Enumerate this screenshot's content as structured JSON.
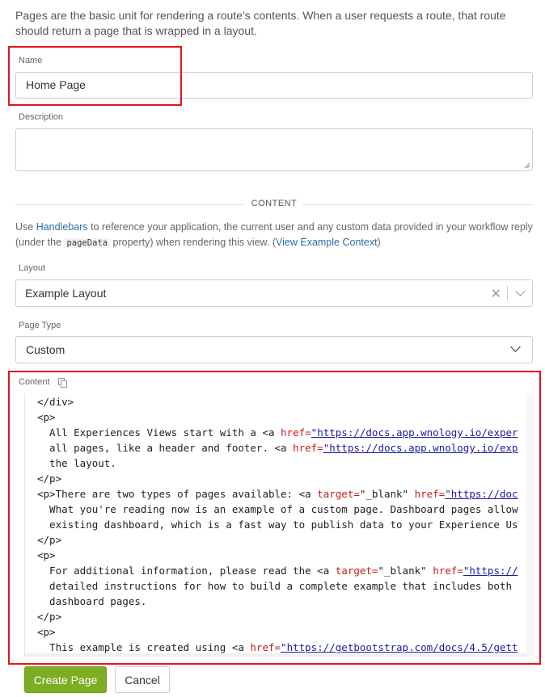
{
  "intro": "Pages are the basic unit for rendering a route's contents. When a user requests a route, that route should return a page that is wrapped in a layout.",
  "name_field": {
    "label": "Name",
    "value": "Home Page"
  },
  "description_field": {
    "label": "Description",
    "value": ""
  },
  "content_divider": "CONTENT",
  "help": {
    "use": "Use ",
    "handlebars_link": "Handlebars",
    "text1": " to reference your application, the current user and any custom data provided in your workflow reply (under the ",
    "code": "pageData",
    "text2": " property) when rendering this view. (",
    "context_link": "View Example Context",
    "text3": ")"
  },
  "layout_field": {
    "label": "Layout",
    "value": "Example Layout"
  },
  "page_type_field": {
    "label": "Page Type",
    "value": "Custom"
  },
  "content_field": {
    "label": "Content"
  },
  "code_lines": [
    [
      {
        "t": "</div>"
      }
    ],
    [
      {
        "t": "<p>"
      }
    ],
    [
      {
        "t": "  All Experiences Views start with a <a "
      },
      {
        "t": "href=",
        "c": "attr"
      },
      {
        "t": "\"https://docs.app.wnology.io/exper",
        "c": "str"
      }
    ],
    [
      {
        "t": "  all pages, like a header and footer. <a "
      },
      {
        "t": "href=",
        "c": "attr"
      },
      {
        "t": "\"https://docs.app.wnology.io/exp",
        "c": "str"
      }
    ],
    [
      {
        "t": "  the layout."
      }
    ],
    [
      {
        "t": "</p>"
      }
    ],
    [
      {
        "t": "<p>There are two types of pages available: <a "
      },
      {
        "t": "target=",
        "c": "attr"
      },
      {
        "t": "\"_blank\" "
      },
      {
        "t": "href=",
        "c": "attr"
      },
      {
        "t": "\"https://doc",
        "c": "str"
      }
    ],
    [
      {
        "t": "  What you're reading now is an example of a custom page. Dashboard pages allow"
      }
    ],
    [
      {
        "t": "  existing dashboard, which is a fast way to publish data to your Experience Us"
      }
    ],
    [
      {
        "t": "</p>"
      }
    ],
    [
      {
        "t": "<p>"
      }
    ],
    [
      {
        "t": "  For additional information, please read the <a "
      },
      {
        "t": "target=",
        "c": "attr"
      },
      {
        "t": "\"_blank\" "
      },
      {
        "t": "href=",
        "c": "attr"
      },
      {
        "t": "\"https://",
        "c": "str"
      }
    ],
    [
      {
        "t": "  detailed instructions for how to build a complete example that includes both"
      }
    ],
    [
      {
        "t": "  dashboard pages."
      }
    ],
    [
      {
        "t": "</p>"
      }
    ],
    [
      {
        "t": "<p>"
      }
    ],
    [
      {
        "t": "  This example is created using <a "
      },
      {
        "t": "href=",
        "c": "attr"
      },
      {
        "t": "\"https://getbootstrap.com/docs/4.5/gett",
        "c": "str"
      }
    ]
  ],
  "buttons": {
    "create": "Create Page",
    "cancel": "Cancel"
  },
  "colors": {
    "primary": "#7cad22",
    "highlight": "#e3141b",
    "link": "#2b6ca8"
  },
  "icons": {
    "clear": "close-icon",
    "dropdown": "chevron-down-icon",
    "copy": "copy-icon"
  }
}
